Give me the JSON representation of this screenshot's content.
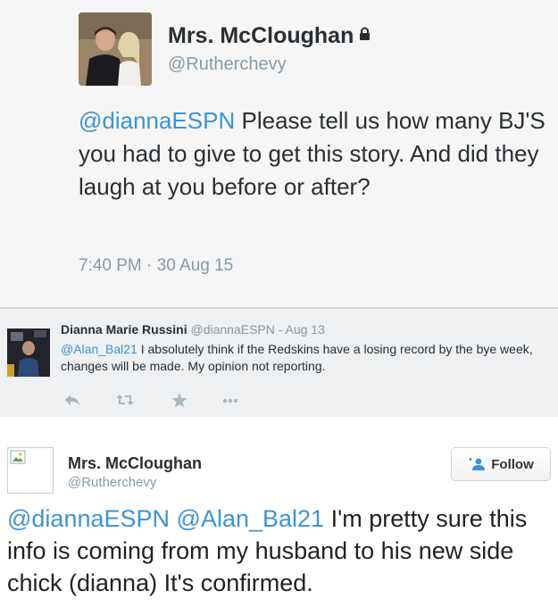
{
  "tweet1": {
    "name": "Mrs. McCloughan",
    "handle": "@Rutherchevy",
    "mention": "@diannaESPN",
    "text": " Please tell us how many BJ'S you had to give to get this story.  And did they laugh at you before or after?",
    "time": "7:40 PM",
    "separator": "·",
    "date": "30 Aug 15",
    "icons": {
      "lock": "lock-icon"
    }
  },
  "tweet2": {
    "name": "Dianna Marie Russini",
    "handle": "@diannaESPN",
    "date": "- Aug 13",
    "mention": "@Alan_Bal21",
    "text": " I absolutely think if the Redskins have a losing record by the bye week, changes will be made. My opinion not reporting.",
    "actions": [
      "reply-icon",
      "retweet-icon",
      "favorite-icon",
      "more-icon"
    ]
  },
  "tweet3": {
    "name": "Mrs. McCloughan",
    "handle": "@Rutherchevy",
    "follow_label": "Follow",
    "mention1": "@diannaESPN",
    "mention2": "@Alan_Bal21",
    "text": " I'm pretty sure this info is coming from my husband to his new side chick (dianna) It's confirmed."
  },
  "colors": {
    "link": "#3b94d9",
    "muted": "#8899a6",
    "text": "#292f33"
  }
}
